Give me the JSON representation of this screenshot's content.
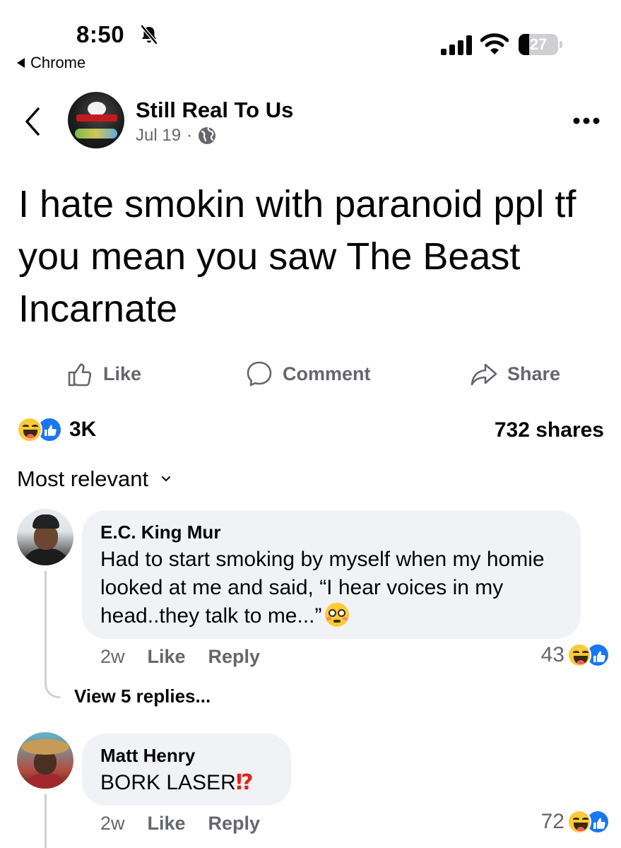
{
  "status_bar": {
    "time": "8:50",
    "back_app": "Chrome",
    "battery": "27",
    "battery_level": 0.27
  },
  "header": {
    "page_name": "Still Real To Us",
    "date": "Jul 19",
    "separator": "·"
  },
  "post": {
    "text": "I hate smokin with paranoid ppl tf you mean you saw The Beast Incarnate"
  },
  "actions": {
    "like": "Like",
    "comment": "Comment",
    "share": "Share"
  },
  "summary": {
    "reaction_count": "3K",
    "shares": "732 shares"
  },
  "sort": {
    "label": "Most relevant"
  },
  "comments": [
    {
      "author": "E.C. King Mur",
      "text": "Had to start smoking by myself when my homie looked at me and said, “I hear voices in my head..they talk to me...”",
      "age": "2w",
      "like": "Like",
      "reply": "Reply",
      "reaction_count": "43",
      "view_replies": "View 5 replies..."
    },
    {
      "author": "Matt Henry",
      "text": "BORK LASER",
      "emoji": "⁉",
      "age": "2w",
      "like": "Like",
      "reply": "Reply",
      "reaction_count": "72"
    }
  ],
  "icons": {
    "back": "chevron-left-icon",
    "more": "more-dots-icon",
    "audience": "globe-icon",
    "like": "thumbs-up-outline-icon",
    "comment": "comment-bubble-icon",
    "share": "share-arrow-icon",
    "reaction_haha": "haha-emoji-icon",
    "reaction_like": "like-reaction-icon"
  },
  "colors": {
    "text_primary": "#050505",
    "text_secondary": "#65676b",
    "bubble_bg": "#f0f2f5",
    "like_blue": "#1877f2",
    "haha_yellow": "#fcc93a"
  }
}
